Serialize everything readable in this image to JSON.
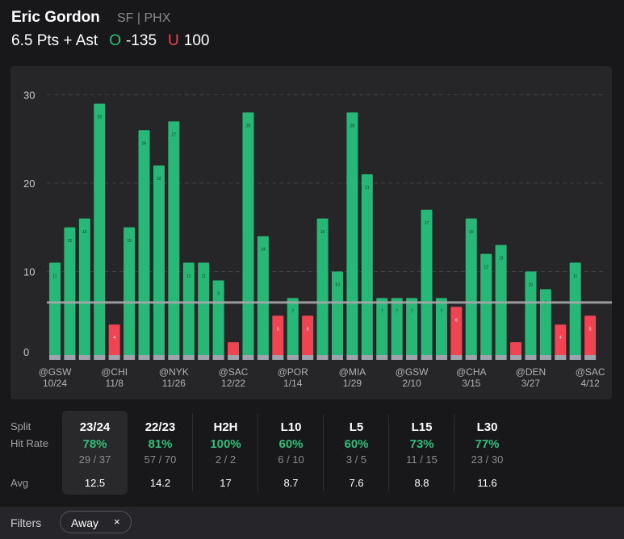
{
  "header": {
    "player": "Eric Gordon",
    "team": "SF | PHX",
    "line": "6.5 Pts + Ast",
    "over_symbol": "O",
    "over_odds": "-135",
    "under_symbol": "U",
    "under_odds": "100"
  },
  "colors": {
    "over": "#27b877",
    "under": "#ef4452",
    "base": "#9ea3ad"
  },
  "chart_data": {
    "type": "bar",
    "threshold": 6.5,
    "ylim": [
      0,
      30
    ],
    "yticks": [
      "0",
      "10",
      "20",
      "30"
    ],
    "values": [
      11,
      15,
      16,
      29,
      4,
      15,
      26,
      22,
      27,
      11,
      11,
      9,
      2,
      28,
      14,
      5,
      7,
      5,
      16,
      10,
      28,
      21,
      7,
      7,
      7,
      17,
      7,
      6,
      16,
      12,
      13,
      2,
      10,
      8,
      4,
      11,
      5
    ],
    "labeled": [
      true,
      true,
      true,
      true,
      true,
      true,
      true,
      true,
      true,
      true,
      true,
      true,
      false,
      true,
      true,
      true,
      true,
      true,
      true,
      true,
      true,
      true,
      true,
      true,
      true,
      true,
      true,
      true,
      true,
      true,
      true,
      false,
      true,
      true,
      true,
      true,
      true
    ],
    "xlabels": [
      {
        "index": 0,
        "opp": "@GSW",
        "date": "10/24"
      },
      {
        "index": 4,
        "opp": "@CHI",
        "date": "11/8"
      },
      {
        "index": 8,
        "opp": "@NYK",
        "date": "11/26"
      },
      {
        "index": 12,
        "opp": "@SAC",
        "date": "12/22"
      },
      {
        "index": 16,
        "opp": "@POR",
        "date": "1/14"
      },
      {
        "index": 20,
        "opp": "@MIA",
        "date": "1/29"
      },
      {
        "index": 24,
        "opp": "@GSW",
        "date": "2/10"
      },
      {
        "index": 28,
        "opp": "@CHA",
        "date": "3/15"
      },
      {
        "index": 32,
        "opp": "@DEN",
        "date": "3/27"
      },
      {
        "index": 36,
        "opp": "@SAC",
        "date": "4/12"
      }
    ]
  },
  "stats": {
    "labels": {
      "split": "Split",
      "hit_rate": "Hit Rate",
      "avg": "Avg"
    },
    "columns": [
      {
        "split": "23/24",
        "rate": "78%",
        "frac": "29 / 37",
        "avg": "12.5"
      },
      {
        "split": "22/23",
        "rate": "81%",
        "frac": "57 / 70",
        "avg": "14.2"
      },
      {
        "split": "H2H",
        "rate": "100%",
        "frac": "2 / 2",
        "avg": "17"
      },
      {
        "split": "L10",
        "rate": "60%",
        "frac": "6 / 10",
        "avg": "8.7"
      },
      {
        "split": "L5",
        "rate": "60%",
        "frac": "3 / 5",
        "avg": "7.6"
      },
      {
        "split": "L15",
        "rate": "73%",
        "frac": "11 / 15",
        "avg": "8.8"
      },
      {
        "split": "L30",
        "rate": "77%",
        "frac": "23 / 30",
        "avg": "11.6"
      }
    ]
  },
  "filters": {
    "label": "Filters",
    "chip": "Away",
    "remove": "×"
  }
}
